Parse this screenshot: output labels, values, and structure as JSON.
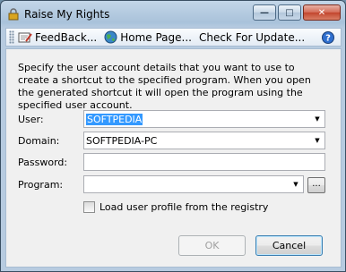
{
  "window": {
    "title": "Raise My Rights",
    "controls": {
      "minimize": "—",
      "maximize": "□",
      "close": "✕"
    }
  },
  "toolbar": {
    "feedback_label": "FeedBack...",
    "homepage_label": "Home Page...",
    "check_update_label": "Check For Update...",
    "help_symbol": "?"
  },
  "description": "Specify the user account details that you want to use to create a shortcut to the specified program. When you open the generated shortcut it will open the program using the specified user account.",
  "form": {
    "user_label": "User:",
    "user_value": "SOFTPEDIA",
    "domain_label": "Domain:",
    "domain_value": "SOFTPEDIA-PC",
    "password_label": "Password:",
    "password_value": "",
    "program_label": "Program:",
    "program_value": "",
    "browse_label": "...",
    "load_profile_label": "Load user profile from the registry",
    "load_profile_checked": false
  },
  "buttons": {
    "ok_label": "OK",
    "cancel_label": "Cancel"
  },
  "colors": {
    "selection": "#3399ff",
    "window_frame": "#b7cbe0",
    "client": "#f0f0f0"
  }
}
